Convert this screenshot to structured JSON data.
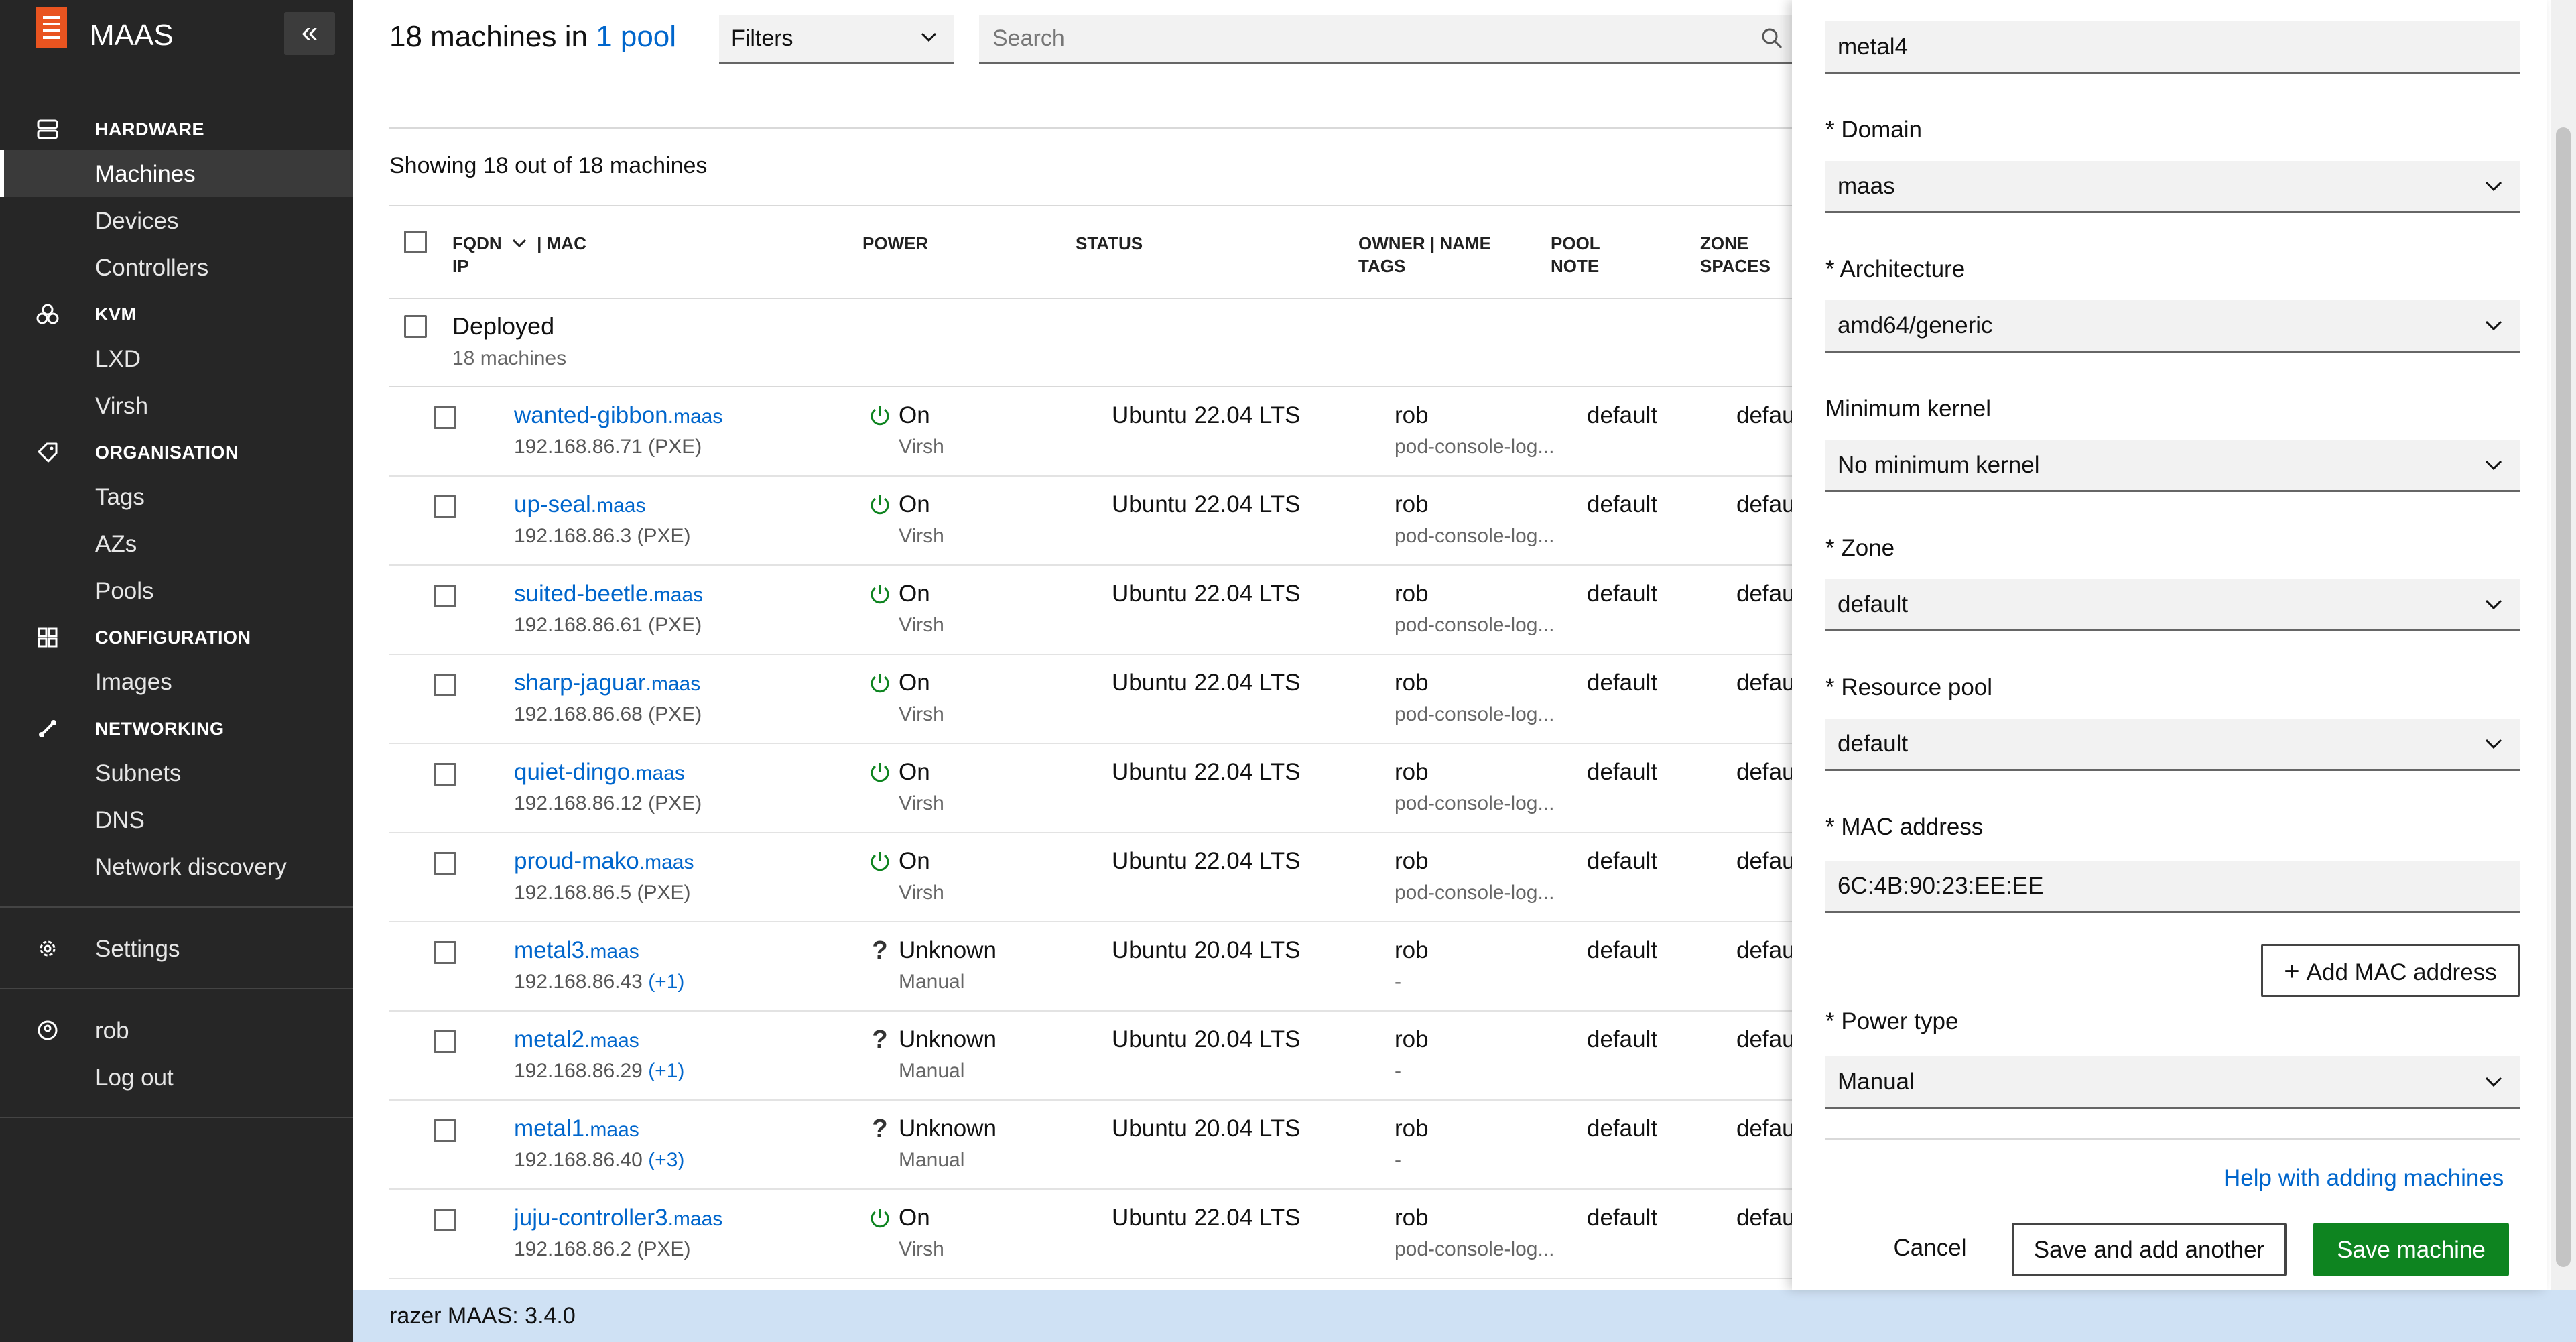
{
  "app": {
    "brand": "MAAS"
  },
  "sidebar": {
    "sections": {
      "hardware": {
        "label": "HARDWARE",
        "items": [
          "Machines",
          "Devices",
          "Controllers"
        ]
      },
      "kvm": {
        "label": "KVM",
        "items": [
          "LXD",
          "Virsh"
        ]
      },
      "organisation": {
        "label": "ORGANISATION",
        "items": [
          "Tags",
          "AZs",
          "Pools"
        ]
      },
      "configuration": {
        "label": "CONFIGURATION",
        "items": [
          "Images"
        ]
      },
      "networking": {
        "label": "NETWORKING",
        "items": [
          "Subnets",
          "DNS",
          "Network discovery"
        ]
      }
    },
    "settings": "Settings",
    "user": "rob",
    "logout": "Log out",
    "active_item": "Machines"
  },
  "header": {
    "title_prefix": "18 machines in ",
    "title_link": "1 pool",
    "filters_label": "Filters",
    "search_placeholder": "Search"
  },
  "list": {
    "showing": "Showing 18 out of 18 machines",
    "columns": {
      "fqdn": "FQDN",
      "mac": "| MAC",
      "ip": "IP",
      "power": "POWER",
      "status": "STATUS",
      "owner": "OWNER | NAME",
      "tags": "TAGS",
      "pool": "POOL",
      "note": "NOTE",
      "zone": "ZONE",
      "spaces": "SPACES"
    },
    "group": {
      "title": "Deployed",
      "count": "18 machines"
    },
    "rows": [
      {
        "name": "wanted-gibbon",
        "domain": ".maas",
        "ip": "192.168.86.71 (PXE)",
        "ip_extra": "",
        "power": "On",
        "power_type": "Virsh",
        "status": "Ubuntu 22.04 LTS",
        "owner": "rob",
        "tags": "pod-console-log...",
        "pool": "default",
        "zone": "default"
      },
      {
        "name": "up-seal",
        "domain": ".maas",
        "ip": "192.168.86.3 (PXE)",
        "ip_extra": "",
        "power": "On",
        "power_type": "Virsh",
        "status": "Ubuntu 22.04 LTS",
        "owner": "rob",
        "tags": "pod-console-log...",
        "pool": "default",
        "zone": "default"
      },
      {
        "name": "suited-beetle",
        "domain": ".maas",
        "ip": "192.168.86.61 (PXE)",
        "ip_extra": "",
        "power": "On",
        "power_type": "Virsh",
        "status": "Ubuntu 22.04 LTS",
        "owner": "rob",
        "tags": "pod-console-log...",
        "pool": "default",
        "zone": "default"
      },
      {
        "name": "sharp-jaguar",
        "domain": ".maas",
        "ip": "192.168.86.68 (PXE)",
        "ip_extra": "",
        "power": "On",
        "power_type": "Virsh",
        "status": "Ubuntu 22.04 LTS",
        "owner": "rob",
        "tags": "pod-console-log...",
        "pool": "default",
        "zone": "default"
      },
      {
        "name": "quiet-dingo",
        "domain": ".maas",
        "ip": "192.168.86.12 (PXE)",
        "ip_extra": "",
        "power": "On",
        "power_type": "Virsh",
        "status": "Ubuntu 22.04 LTS",
        "owner": "rob",
        "tags": "pod-console-log...",
        "pool": "default",
        "zone": "default"
      },
      {
        "name": "proud-mako",
        "domain": ".maas",
        "ip": "192.168.86.5 (PXE)",
        "ip_extra": "",
        "power": "On",
        "power_type": "Virsh",
        "status": "Ubuntu 22.04 LTS",
        "owner": "rob",
        "tags": "pod-console-log...",
        "pool": "default",
        "zone": "default"
      },
      {
        "name": "metal3",
        "domain": ".maas",
        "ip": "192.168.86.43 ",
        "ip_extra": "(+1)",
        "power": "Unknown",
        "power_type": "Manual",
        "status": "Ubuntu 20.04 LTS",
        "owner": "rob",
        "tags": "-",
        "pool": "default",
        "zone": "default"
      },
      {
        "name": "metal2",
        "domain": ".maas",
        "ip": "192.168.86.29 ",
        "ip_extra": "(+1)",
        "power": "Unknown",
        "power_type": "Manual",
        "status": "Ubuntu 20.04 LTS",
        "owner": "rob",
        "tags": "-",
        "pool": "default",
        "zone": "default"
      },
      {
        "name": "metal1",
        "domain": ".maas",
        "ip": "192.168.86.40 ",
        "ip_extra": "(+3)",
        "power": "Unknown",
        "power_type": "Manual",
        "status": "Ubuntu 20.04 LTS",
        "owner": "rob",
        "tags": "-",
        "pool": "default",
        "zone": "default"
      },
      {
        "name": "juju-controller3",
        "domain": ".maas",
        "ip": "192.168.86.2 (PXE)",
        "ip_extra": "",
        "power": "On",
        "power_type": "Virsh",
        "status": "Ubuntu 22.04 LTS",
        "owner": "rob",
        "tags": "pod-console-log...",
        "pool": "default",
        "zone": "default"
      }
    ]
  },
  "footer": {
    "label": "razer MAAS:",
    "version": " 3.4.0"
  },
  "panel": {
    "hostname_value": "metal4",
    "domain_label": "* Domain",
    "domain_value": "maas",
    "arch_label": "* Architecture",
    "arch_value": "amd64/generic",
    "kernel_label": "Minimum kernel",
    "kernel_value": "No minimum kernel",
    "zone_label": "* Zone",
    "zone_value": "default",
    "pool_label": "* Resource pool",
    "pool_value": "default",
    "mac_label": "* MAC address",
    "mac_value": "6C:4B:90:23:EE:EE",
    "add_mac": "Add MAC address",
    "power_label": "* Power type",
    "power_value": "Manual",
    "help_link": "Help with adding machines",
    "cancel": "Cancel",
    "save_another": "Save and add another",
    "save": "Save machine"
  },
  "colors": {
    "accent": "#e95420",
    "link": "#0066cc",
    "positive": "#0e8420",
    "sidebar": "#262626",
    "footer": "#cfe1f4"
  }
}
